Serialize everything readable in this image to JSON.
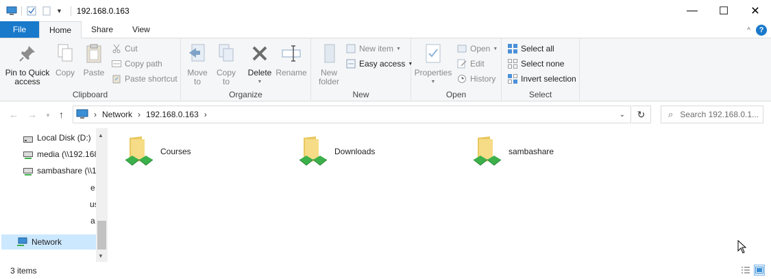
{
  "window": {
    "title": "192.168.0.163",
    "controls": {
      "minimize": "—",
      "maximize": "☐",
      "close": "✕"
    }
  },
  "tabs": [
    {
      "label": "File"
    },
    {
      "label": "Home"
    },
    {
      "label": "Share"
    },
    {
      "label": "View"
    }
  ],
  "ribbon": {
    "clipboard": {
      "label": "Clipboard",
      "pin_line1": "Pin to Quick",
      "pin_line2": "access",
      "copy": "Copy",
      "paste": "Paste",
      "cut": "Cut",
      "copy_path": "Copy path",
      "paste_shortcut": "Paste shortcut"
    },
    "organize": {
      "label": "Organize",
      "move_line1": "Move",
      "move_line2": "to",
      "copy_line1": "Copy",
      "copy_line2": "to",
      "delete": "Delete",
      "rename": "Rename"
    },
    "new": {
      "label": "New",
      "folder_line1": "New",
      "folder_line2": "folder",
      "new_item": "New item",
      "easy_access": "Easy access"
    },
    "open": {
      "label": "Open",
      "properties": "Properties",
      "open": "Open",
      "edit": "Edit",
      "history": "History"
    },
    "select": {
      "label": "Select",
      "select_all": "Select all",
      "select_none": "Select none",
      "invert": "Invert selection"
    }
  },
  "address": {
    "crumbs": [
      "Network",
      "192.168.0.163"
    ],
    "search_placeholder": "Search 192.168.0.1..."
  },
  "navpane": {
    "items": [
      {
        "label": "Local Disk (D:)"
      },
      {
        "label": "media (\\\\192.168"
      },
      {
        "label": "sambashare (\\\\1"
      }
    ],
    "fragments": [
      "e",
      "us",
      "a"
    ],
    "network": "Network"
  },
  "content": {
    "items": [
      {
        "label": "Courses"
      },
      {
        "label": "Downloads"
      },
      {
        "label": "sambashare"
      }
    ]
  },
  "status": {
    "count": "3 items"
  },
  "colors": {
    "accent": "#1979ca",
    "selection": "#cce8ff",
    "folder": "#f4d774"
  }
}
